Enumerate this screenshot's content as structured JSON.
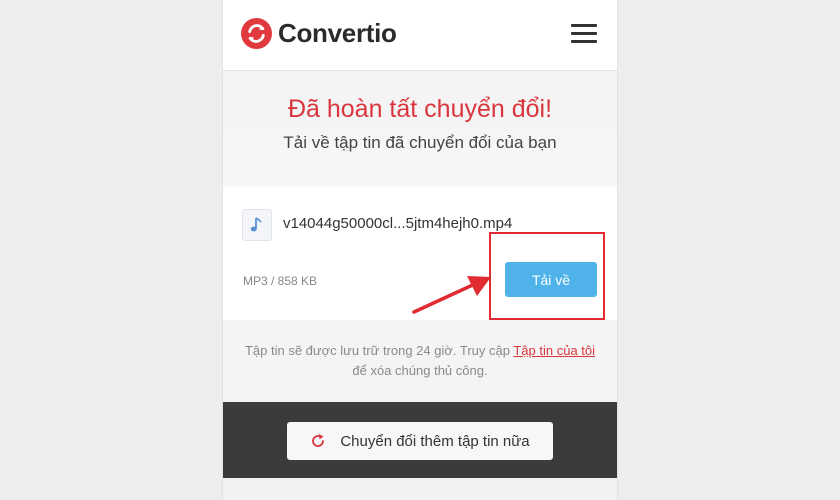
{
  "header": {
    "brand": "Convertio",
    "brand_color": "#e03a3e"
  },
  "hero": {
    "title": "Đã hoàn tất chuyển đổi!",
    "subtitle": "Tải về tập tin đã chuyển đổi của bạn"
  },
  "file": {
    "icon": "music-note-icon",
    "name": "v14044g50000cl...5jtm4hejh0.mp4",
    "meta": "MP3 / 858 KB",
    "download_label": "Tải về"
  },
  "info": {
    "text_before": "Tập tin sẽ được lưu trữ trong 24 giờ. Truy cập ",
    "link": "Tập tin của tôi",
    "text_after": " để xóa chúng thủ công."
  },
  "actions": {
    "convert_more_label": "Chuyển đổi thêm tập tin nữa",
    "icon": "refresh-icon"
  },
  "colors": {
    "accent_red": "#d9363e",
    "button_blue": "#4fb3ea",
    "dark_band": "#3b3b3b"
  }
}
